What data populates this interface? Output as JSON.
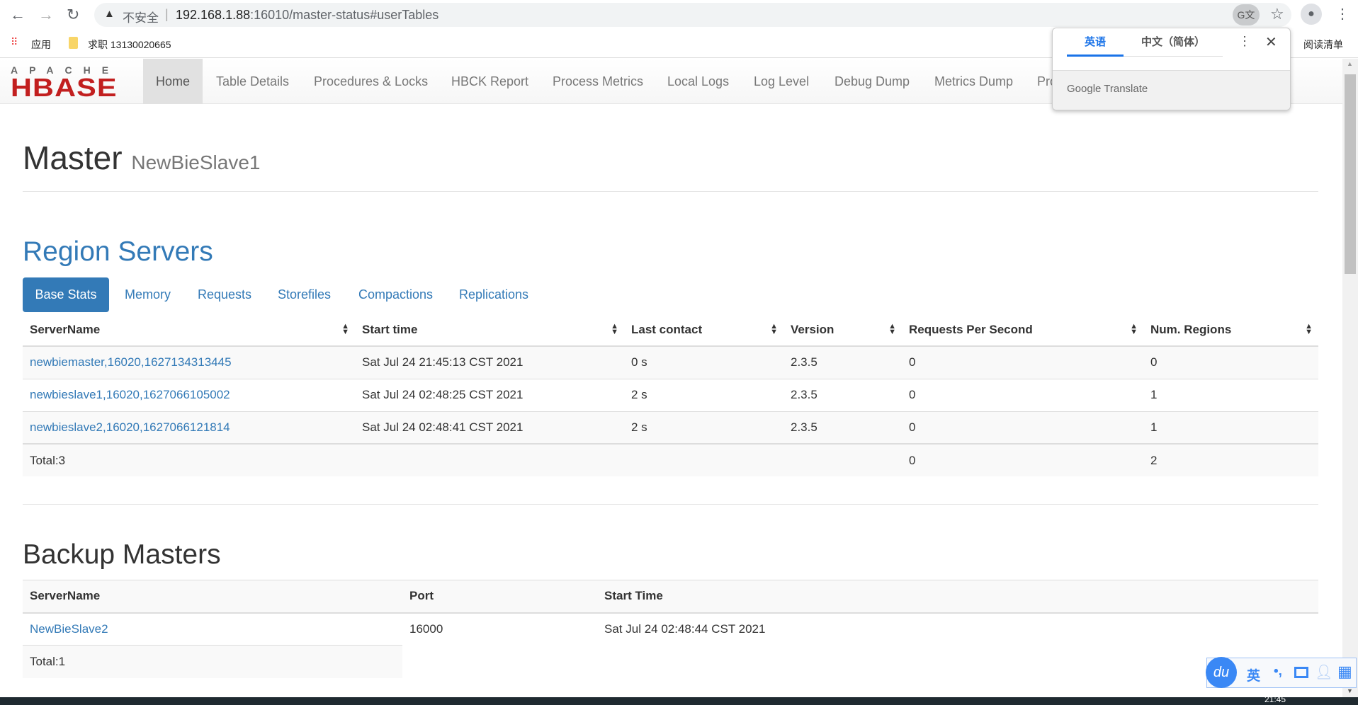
{
  "browser": {
    "security": "不安全",
    "url_host": "192.168.1.88",
    "url_rest": ":16010/master-status#userTables",
    "bookmarks": [
      "应用",
      "求职 13130020665"
    ],
    "reading_list": "阅读清单"
  },
  "translate": {
    "source": "英语",
    "target": "中文（简体）",
    "footer": "Google Translate"
  },
  "nav": {
    "logo_top": "APACHE",
    "logo_main": "HBASE",
    "items": [
      "Home",
      "Table Details",
      "Procedures & Locks",
      "HBCK Report",
      "Process Metrics",
      "Local Logs",
      "Log Level",
      "Debug Dump",
      "Metrics Dump",
      "Pro"
    ]
  },
  "page": {
    "title": "Master",
    "subtitle": "NewBieSlave1"
  },
  "region_servers": {
    "heading": "Region Servers",
    "tabs": [
      "Base Stats",
      "Memory",
      "Requests",
      "Storefiles",
      "Compactions",
      "Replications"
    ],
    "columns": [
      "ServerName",
      "Start time",
      "Last contact",
      "Version",
      "Requests Per Second",
      "Num. Regions"
    ],
    "rows": [
      [
        "newbiemaster,16020,1627134313445",
        "Sat Jul 24 21:45:13 CST 2021",
        "0 s",
        "2.3.5",
        "0",
        "0"
      ],
      [
        "newbieslave1,16020,1627066105002",
        "Sat Jul 24 02:48:25 CST 2021",
        "2 s",
        "2.3.5",
        "0",
        "1"
      ],
      [
        "newbieslave2,16020,1627066121814",
        "Sat Jul 24 02:48:41 CST 2021",
        "2 s",
        "2.3.5",
        "0",
        "1"
      ]
    ],
    "total": {
      "label": "Total:3",
      "requests": "0",
      "regions": "2"
    }
  },
  "backup_masters": {
    "heading": "Backup Masters",
    "columns": [
      "ServerName",
      "Port",
      "Start Time"
    ],
    "rows": [
      [
        "NewBieSlave2",
        "16000",
        "Sat Jul 24 02:48:44 CST 2021"
      ]
    ],
    "total": "Total:1"
  },
  "ime": {
    "logo": "du",
    "lang": "英"
  },
  "taskbar": {
    "time": "21:45"
  }
}
